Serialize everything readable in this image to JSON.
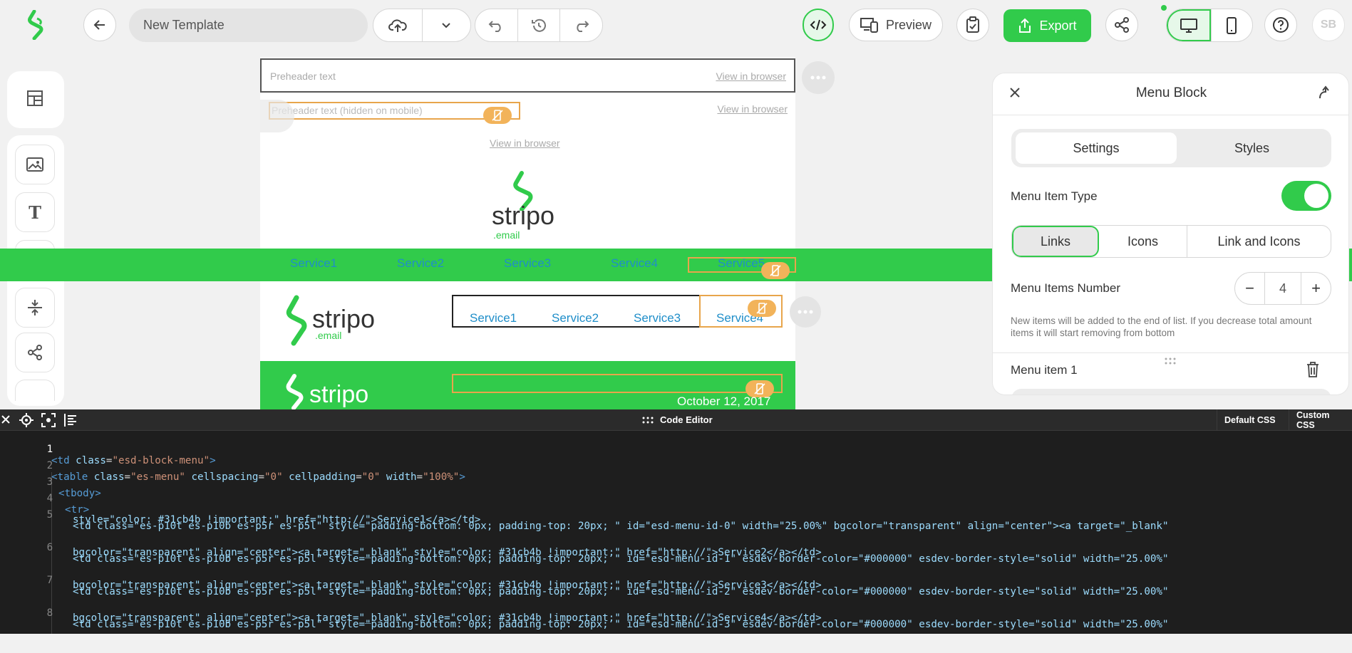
{
  "toolbar": {
    "template_name": "New Template",
    "preview_label": "Preview",
    "export_label": "Export",
    "avatar_initials": "SB"
  },
  "canvas": {
    "preheader_placeholder": "Preheader text",
    "preheader_hidden": "Preheader text (hidden on mobile)",
    "view_in_browser": "View in browser",
    "logo_text": "stripo",
    "logo_sub": ".email",
    "menu_items": [
      "Service1",
      "Service2",
      "Service3",
      "Service4",
      "Service5"
    ],
    "date_text": "October 12, 2017"
  },
  "panel": {
    "title": "Menu Block",
    "tab_settings": "Settings",
    "tab_styles": "Styles",
    "menu_item_type_label": "Menu Item Type",
    "type_links": "Links",
    "type_icons": "Icons",
    "type_link_icons": "Link and Icons",
    "items_number_label": "Menu Items Number",
    "items_number_value": "4",
    "minus": "−",
    "plus": "+",
    "hint": "New items will be added to the end of list. If you decrease total amount items it will start removing from bottom",
    "menu_item_1": "Menu item 1"
  },
  "code_editor": {
    "title": "Code Editor",
    "default_css": "Default CSS",
    "custom_css": "Custom CSS",
    "line_numbers": [
      "1",
      "2",
      "3",
      "4",
      "5",
      "6",
      "7",
      "8"
    ],
    "l1_a": "<td ",
    "l1_b": "class",
    "l1_c": "=",
    "l1_d": "\"esd-block-menu\"",
    "l1_e": ">",
    "l2_a": "<table ",
    "l2_b": "class",
    "l2_c": "=",
    "l2_d": "\"es-menu\"",
    "l2_e": " cellspacing",
    "l2_f": "=",
    "l2_g": "\"0\"",
    "l2_h": " cellpadding",
    "l2_i": "=",
    "l2_j": "\"0\"",
    "l2_k": " width",
    "l2_l": "=",
    "l2_m": "\"100%\"",
    "l2_n": ">",
    "l3": "<tbody>",
    "l4": "<tr>",
    "l5a": "<td class=\"es-p10t es-p10b es-p5r es-p5l\" style=\"padding-bottom: 0px; padding-top: 20px; \" id=\"esd-menu-id-0\" width=\"25.00%\" bgcolor=\"transparent\" align=\"center\"><a target=\"_blank\"",
    "l5b": "style=\"color: #31cb4b !important;\" href=\"http://\">Service1</a></td>",
    "l6a": "<td class=\"es-p10t es-p10b es-p5r es-p5l\" style=\"padding-bottom: 0px; padding-top: 20px; \" id=\"esd-menu-id-1\" esdev-border-color=\"#000000\" esdev-border-style=\"solid\" width=\"25.00%\"",
    "l6b": "bgcolor=\"transparent\" align=\"center\"><a target=\"_blank\" style=\"color: #31cb4b !important;\" href=\"http://\">Service2</a></td>",
    "l7a": "<td class=\"es-p10t es-p10b es-p5r es-p5l\" style=\"padding-bottom: 0px; padding-top: 20px; \" id=\"esd-menu-id-2\" esdev-border-color=\"#000000\" esdev-border-style=\"solid\" width=\"25.00%\"",
    "l7b": "bgcolor=\"transparent\" align=\"center\"><a target=\"_blank\" style=\"color: #31cb4b !important;\" href=\"http://\">Service3</a></td>",
    "l8a": "<td class=\"es-p10t es-p10b es-p5r es-p5l\" style=\"padding-bottom: 0px; padding-top: 20px; \" id=\"esd-menu-id-3\" esdev-border-color=\"#000000\" esdev-border-style=\"solid\" width=\"25.00%\"",
    "l8b": "bgcolor=\"transparent\" align=\"center\"><a target=\"_blank\" style=\"color: #31cb4b !important;\" href=\"http://\">Service4</a></td>"
  },
  "colors": {
    "brand_green": "#31cb4b",
    "code_bg": "#1e1e1e",
    "hidden_badge": "#f2b35a",
    "menu_link": "#1f8ec9"
  }
}
